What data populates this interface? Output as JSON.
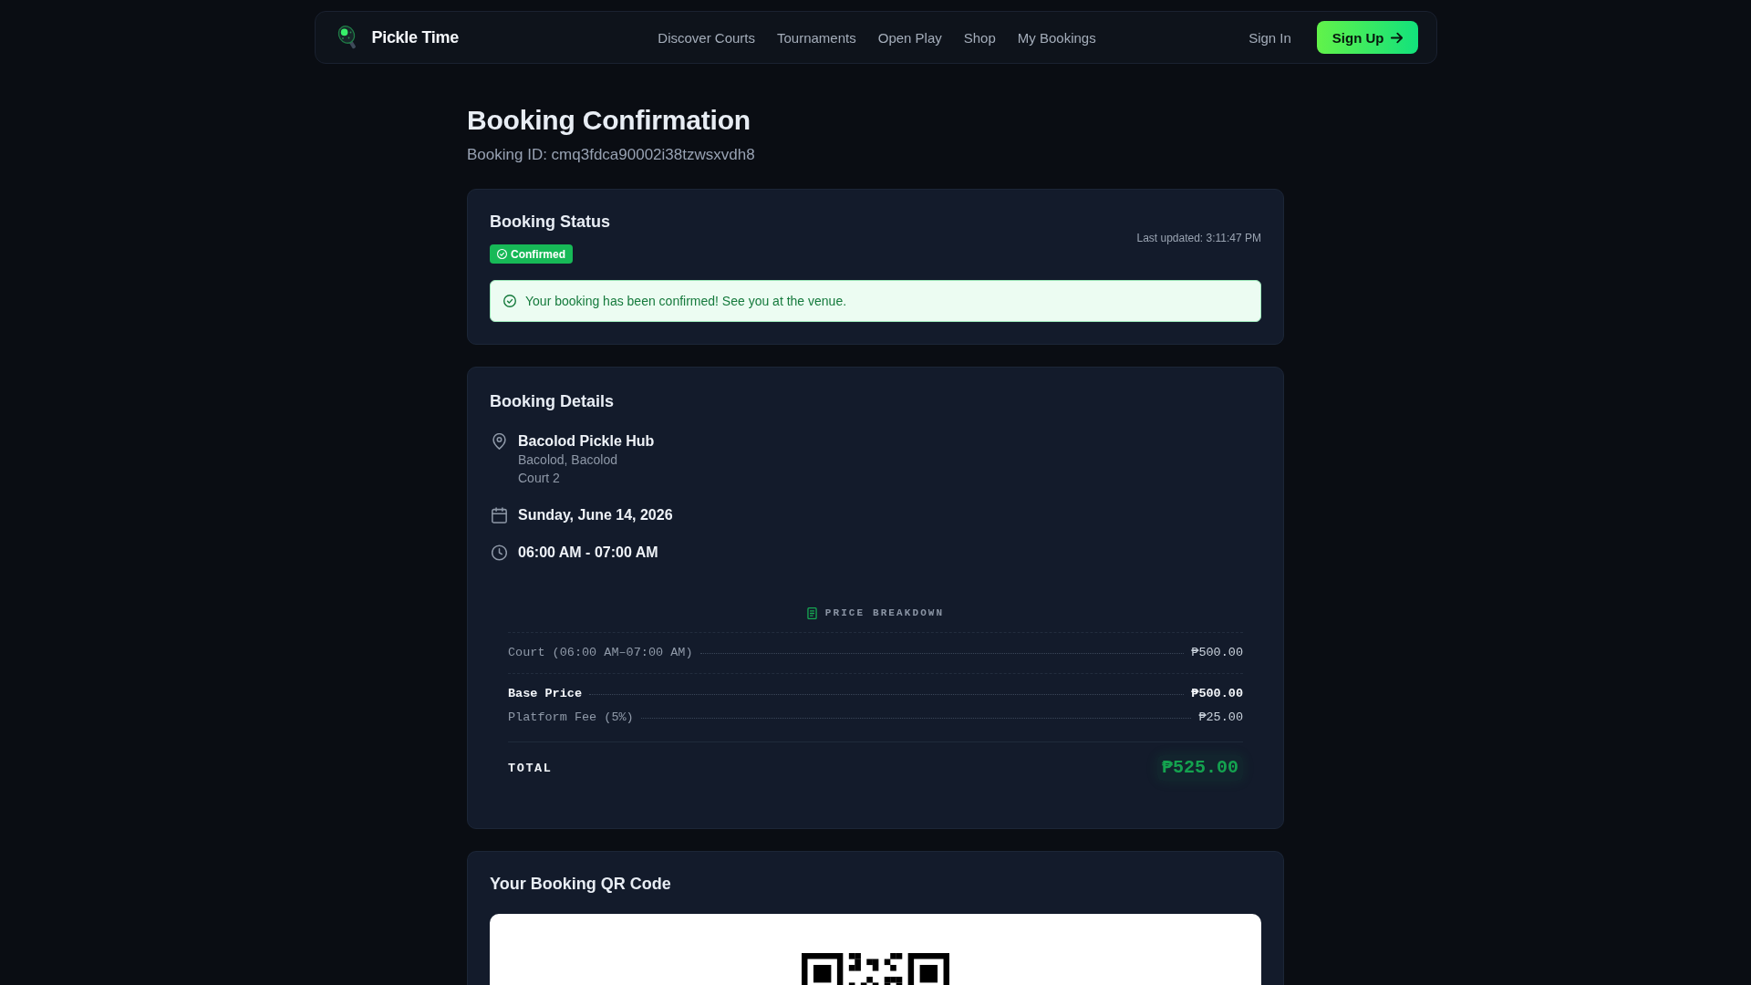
{
  "nav": {
    "brand": "Pickle Time",
    "links": [
      "Discover Courts",
      "Tournaments",
      "Open Play",
      "Shop",
      "My Bookings"
    ],
    "sign_in": "Sign In",
    "sign_up": "Sign Up"
  },
  "header": {
    "title": "Booking Confirmation",
    "booking_id": "Booking ID: cmq3fdca90002i38tzwsxvdh8"
  },
  "status_card": {
    "title": "Booking Status",
    "badge": {
      "kind": "confirmed",
      "label": "Confirmed"
    },
    "last_updated": "Last updated: 3:11:47 PM",
    "alert": {
      "kind": "success",
      "text": "Your booking has been confirmed! See you at the venue."
    }
  },
  "details_card": {
    "title": "Booking Details",
    "items": [
      {
        "kind": "location",
        "lines": [
          "Bacolod Pickle Hub",
          "Bacolod, Bacolod",
          "Court 2"
        ]
      },
      {
        "kind": "date",
        "lines": [
          "Sunday, June 14, 2026"
        ]
      },
      {
        "kind": "time",
        "lines": [
          "06:00 AM - 07:00 AM"
        ]
      }
    ],
    "price_breakdown": {
      "title": "PRICE BREAKDOWN",
      "sections": [
        {
          "rows": [
            {
              "kind": "item",
              "label": "Court (06:00 AM–07:00 AM)",
              "amount": "₱500.00"
            }
          ]
        },
        {
          "rows": [
            {
              "kind": "subtotal",
              "label": "Base Price",
              "amount": "₱500.00"
            },
            {
              "kind": "fee",
              "label": "Platform Fee (5%)",
              "amount": "₱25.00"
            }
          ]
        }
      ],
      "total": {
        "label": "TOTAL",
        "amount": "₱525.00"
      }
    }
  },
  "qr_card": {
    "title": "Your Booking QR Code"
  }
}
